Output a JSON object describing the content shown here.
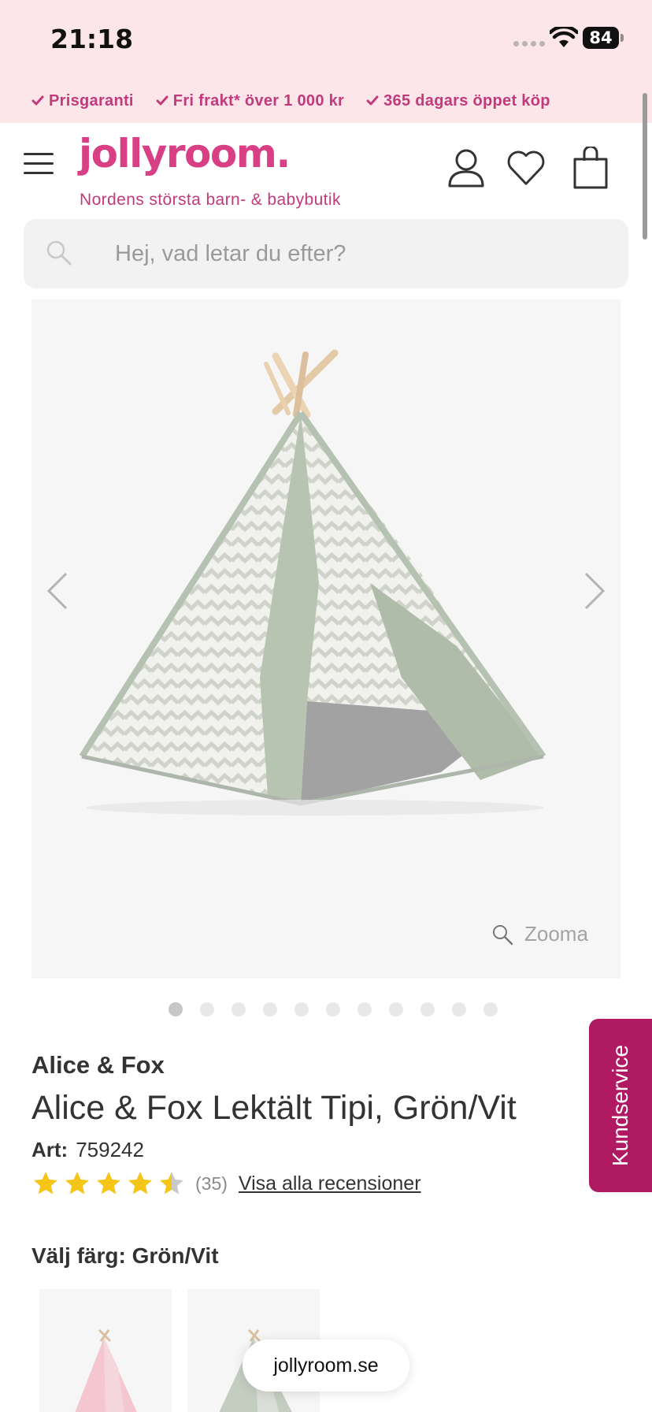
{
  "status_bar": {
    "time": "21:18",
    "battery": "84"
  },
  "usps": [
    {
      "label": "Prisgaranti"
    },
    {
      "label": "Fri frakt* över 1 000 kr"
    },
    {
      "label": "365 dagars öppet köp"
    }
  ],
  "header": {
    "logo": "jollyroom.",
    "tagline": "Nordens största barn- & babybutik"
  },
  "search": {
    "placeholder": "Hej, vad letar du efter?"
  },
  "gallery": {
    "zoom_label": "Zooma",
    "image_count": 11,
    "active_index": 0
  },
  "product": {
    "brand": "Alice & Fox",
    "title": "Alice & Fox Lektält Tipi, Grön/Vit",
    "art_label": "Art:",
    "art_number": "759242",
    "rating": 4.5,
    "review_count": "(35)",
    "reviews_link": "Visa alla recensioner"
  },
  "color_select": {
    "label": "Välj färg: Grön/Vit"
  },
  "kundservice": {
    "label": "Kundservice"
  },
  "browser": {
    "url": "jollyroom.se"
  },
  "colors": {
    "brand_pink": "#d93f84",
    "usp_pink": "#c13a7b",
    "kundservice_bg": "#b01a62",
    "star": "#f5c518",
    "top_bg": "#fde6ea"
  }
}
